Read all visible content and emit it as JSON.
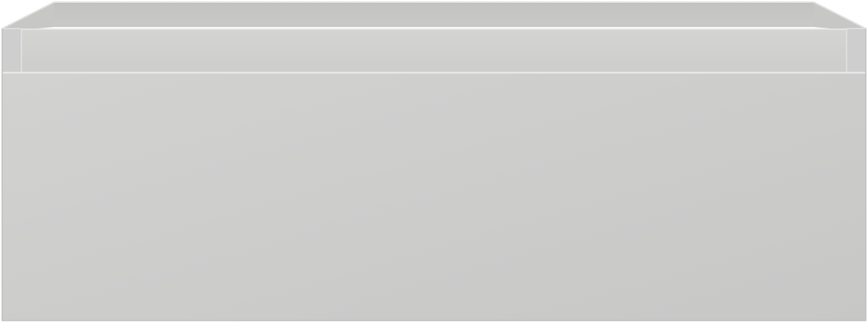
{
  "object": {
    "kind": "drawer-box",
    "colors": {
      "background": "#ffffff",
      "front_panel": "#cbcbca",
      "front_panel_highlight": "#d3d3d2",
      "back_wall": "#c6c6c5",
      "side_panel": "#c9c9c8",
      "rim": "#d1d1d0",
      "edge_line": "#e6e6e5",
      "shadow_line": "#b9b9b8"
    }
  }
}
